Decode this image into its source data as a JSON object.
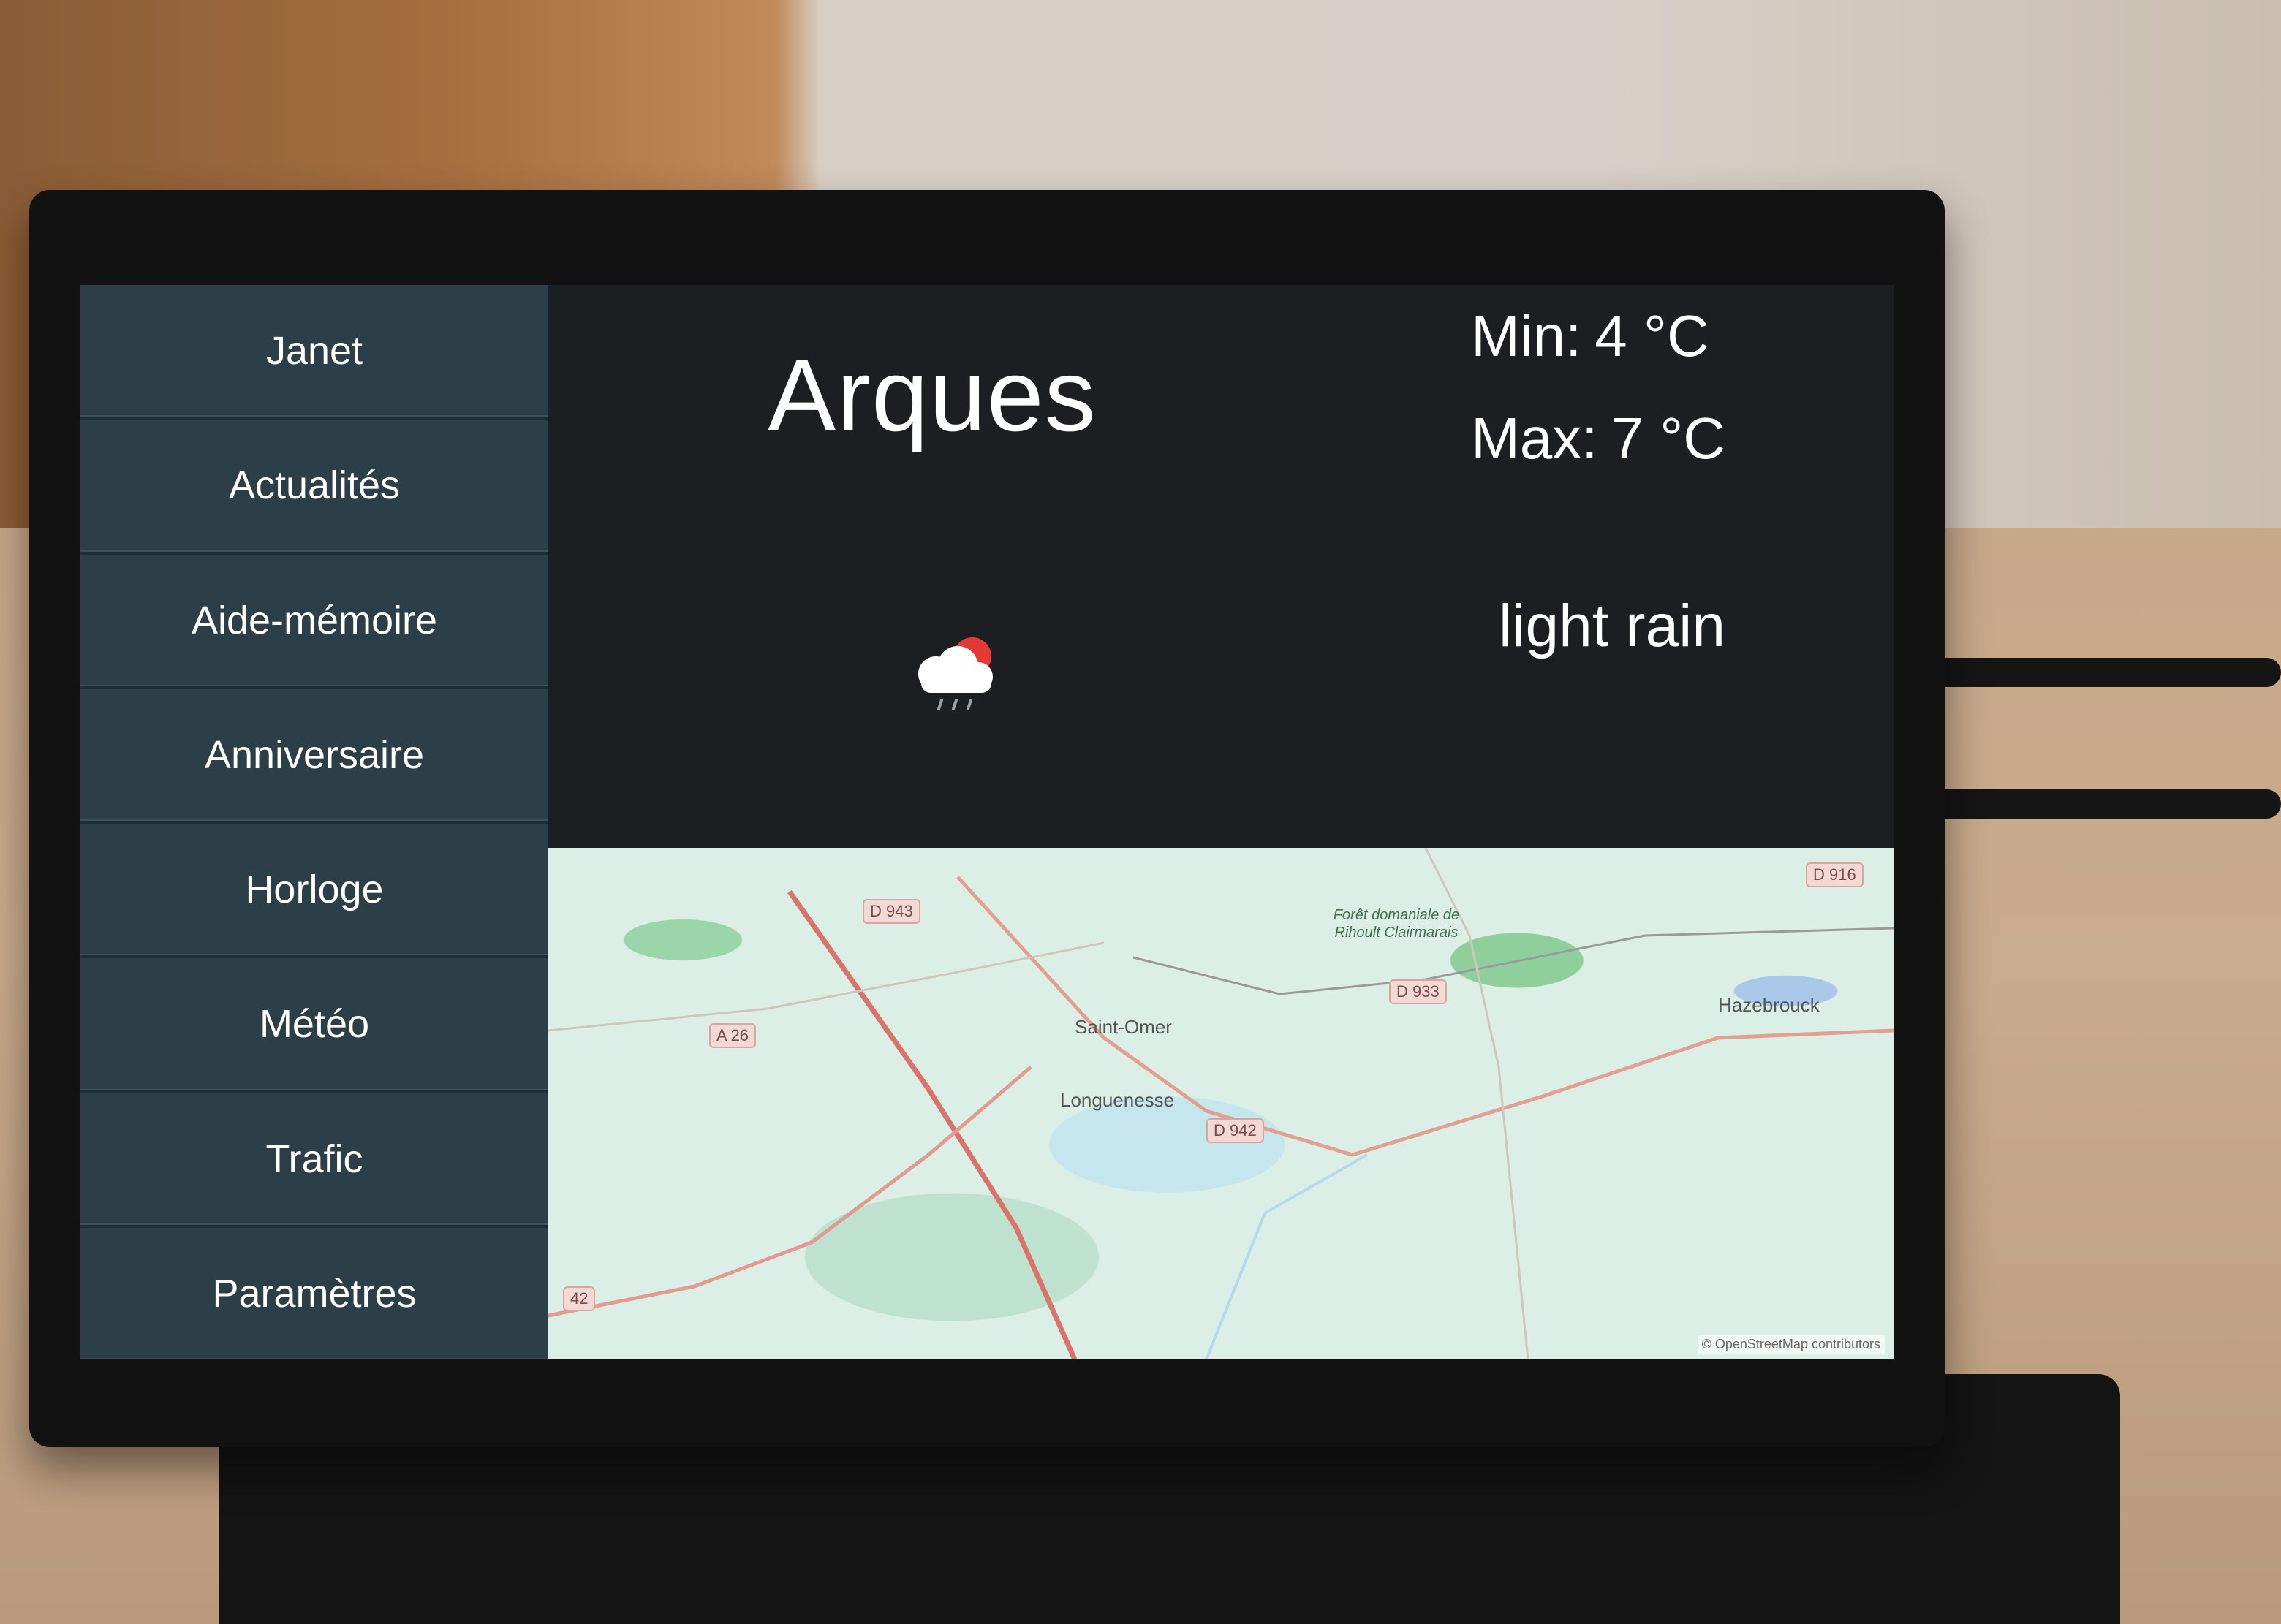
{
  "sidebar": {
    "items": [
      {
        "label": "Janet"
      },
      {
        "label": "Actualités"
      },
      {
        "label": "Aide-mémoire"
      },
      {
        "label": "Anniversaire"
      },
      {
        "label": "Horloge"
      },
      {
        "label": "Météo"
      },
      {
        "label": "Trafic"
      },
      {
        "label": "Paramètres"
      }
    ]
  },
  "weather": {
    "city": "Arques",
    "min_label": "Min:",
    "min_value": "4 °C",
    "max_label": "Max:",
    "max_value": "7 °C",
    "description": "light rain",
    "icon": "cloud-rain-sun-icon"
  },
  "map": {
    "places": {
      "saint_omer": "Saint-Omer",
      "longuenesse": "Longuenesse",
      "hazebrouck": "Hazebrouck",
      "forest": "Forêt domaniale de Rihoult Clairmarais"
    },
    "roads": {
      "a26": "A 26",
      "d943": "D 943",
      "d942": "D 942",
      "d933": "D 933",
      "d916": "D 916",
      "r42": "42"
    },
    "attribution": "© OpenStreetMap contributors"
  },
  "colors": {
    "sidebar_bg": "#2c3f49",
    "main_bg": "#1d1e21",
    "text": "#ffffff",
    "sun_red": "#e53935"
  }
}
